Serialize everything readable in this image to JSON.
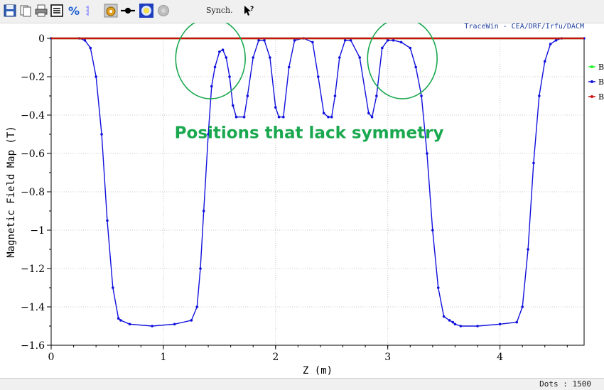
{
  "toolbar": {
    "icons": [
      "save-icon",
      "copy-icon",
      "print-icon",
      "list-icon",
      "percent-icon",
      "bars-icon",
      "settings-icon",
      "marker-line-icon",
      "target-icon",
      "gray-circle-icon",
      "help-pointer-icon"
    ],
    "synch_label": "Synch.",
    "credit": "TraceWin - CEA/DRF/Irfu/DACM"
  },
  "status": {
    "dots": "Dots : 1500"
  },
  "chart_data": {
    "type": "line",
    "xlabel": "Z (m)",
    "ylabel": "Magnetic Field Map (T)",
    "xlim": [
      0,
      4.75
    ],
    "ylim": [
      -1.6,
      0
    ],
    "xticks": [
      "0",
      "1",
      "2",
      "3",
      "4"
    ],
    "yticks": [
      "0",
      "-0.2",
      "-0.4",
      "-0.6",
      "-0.8",
      "-1",
      "-1.2",
      "-1.4",
      "-1.6"
    ],
    "grid": true,
    "legend_position": "right",
    "legend_entries": [
      "B",
      "B",
      "B"
    ],
    "series": [
      {
        "name": "B",
        "color": "#22ee22",
        "x": [
          0,
          4.75
        ],
        "y": [
          0,
          0
        ]
      },
      {
        "name": "B",
        "color": "#1010dd",
        "markers": true,
        "x": [
          0,
          0.25,
          0.3,
          0.35,
          0.4,
          0.45,
          0.5,
          0.55,
          0.6,
          0.62,
          0.7,
          0.9,
          1.1,
          1.25,
          1.3,
          1.33,
          1.36,
          1.4,
          1.43,
          1.46,
          1.5,
          1.53,
          1.56,
          1.59,
          1.62,
          1.65,
          1.72,
          1.75,
          1.8,
          1.85,
          1.9,
          1.95,
          2.0,
          2.03,
          2.07,
          2.12,
          2.17,
          2.25,
          2.33,
          2.38,
          2.43,
          2.47,
          2.5,
          2.53,
          2.57,
          2.62,
          2.67,
          2.75,
          2.83,
          2.86,
          2.9,
          2.95,
          3.0,
          3.05,
          3.12,
          3.2,
          3.25,
          3.3,
          3.35,
          3.4,
          3.45,
          3.5,
          3.55,
          3.58,
          3.6,
          3.65,
          3.8,
          4.0,
          4.15,
          4.2,
          4.25,
          4.3,
          4.35,
          4.4,
          4.45,
          4.5,
          4.55,
          4.75
        ],
        "y": [
          0,
          0,
          -0.01,
          -0.05,
          -0.2,
          -0.5,
          -0.95,
          -1.3,
          -1.46,
          -1.47,
          -1.49,
          -1.5,
          -1.49,
          -1.47,
          -1.4,
          -1.2,
          -0.9,
          -0.5,
          -0.25,
          -0.15,
          -0.07,
          -0.06,
          -0.1,
          -0.2,
          -0.35,
          -0.41,
          -0.41,
          -0.3,
          -0.1,
          -0.01,
          -0.01,
          -0.1,
          -0.36,
          -0.41,
          -0.41,
          -0.15,
          -0.01,
          0,
          -0.02,
          -0.2,
          -0.39,
          -0.41,
          -0.41,
          -0.3,
          -0.1,
          -0.01,
          -0.01,
          -0.1,
          -0.39,
          -0.41,
          -0.3,
          -0.05,
          -0.01,
          -0.01,
          -0.02,
          -0.05,
          -0.15,
          -0.3,
          -0.6,
          -1.0,
          -1.3,
          -1.45,
          -1.47,
          -1.48,
          -1.49,
          -1.5,
          -1.5,
          -1.49,
          -1.48,
          -1.4,
          -1.1,
          -0.65,
          -0.3,
          -0.12,
          -0.03,
          -0.01,
          0,
          0
        ]
      },
      {
        "name": "B",
        "color": "#cc1010",
        "x": [
          0,
          4.75
        ],
        "y": [
          0,
          0
        ]
      }
    ],
    "annotations": [
      {
        "text": "Positions that lack symmetry",
        "x": 1.1,
        "y": -0.52,
        "color": "#1aa84f"
      },
      {
        "shape": "ellipse",
        "cx": 1.42,
        "cy": -0.105,
        "rx": 0.31,
        "ry": 0.21,
        "color": "#1aa84f"
      },
      {
        "shape": "ellipse",
        "cx": 3.13,
        "cy": -0.105,
        "rx": 0.31,
        "ry": 0.21,
        "color": "#1aa84f"
      }
    ]
  }
}
